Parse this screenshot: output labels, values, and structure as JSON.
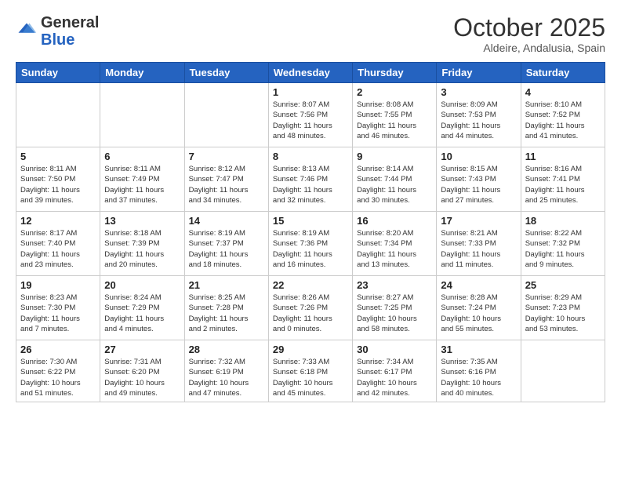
{
  "header": {
    "logo_general": "General",
    "logo_blue": "Blue",
    "month_title": "October 2025",
    "subtitle": "Aldeire, Andalusia, Spain"
  },
  "weekdays": [
    "Sunday",
    "Monday",
    "Tuesday",
    "Wednesday",
    "Thursday",
    "Friday",
    "Saturday"
  ],
  "weeks": [
    [
      {
        "day": "",
        "info": ""
      },
      {
        "day": "",
        "info": ""
      },
      {
        "day": "",
        "info": ""
      },
      {
        "day": "1",
        "info": "Sunrise: 8:07 AM\nSunset: 7:56 PM\nDaylight: 11 hours\nand 48 minutes."
      },
      {
        "day": "2",
        "info": "Sunrise: 8:08 AM\nSunset: 7:55 PM\nDaylight: 11 hours\nand 46 minutes."
      },
      {
        "day": "3",
        "info": "Sunrise: 8:09 AM\nSunset: 7:53 PM\nDaylight: 11 hours\nand 44 minutes."
      },
      {
        "day": "4",
        "info": "Sunrise: 8:10 AM\nSunset: 7:52 PM\nDaylight: 11 hours\nand 41 minutes."
      }
    ],
    [
      {
        "day": "5",
        "info": "Sunrise: 8:11 AM\nSunset: 7:50 PM\nDaylight: 11 hours\nand 39 minutes."
      },
      {
        "day": "6",
        "info": "Sunrise: 8:11 AM\nSunset: 7:49 PM\nDaylight: 11 hours\nand 37 minutes."
      },
      {
        "day": "7",
        "info": "Sunrise: 8:12 AM\nSunset: 7:47 PM\nDaylight: 11 hours\nand 34 minutes."
      },
      {
        "day": "8",
        "info": "Sunrise: 8:13 AM\nSunset: 7:46 PM\nDaylight: 11 hours\nand 32 minutes."
      },
      {
        "day": "9",
        "info": "Sunrise: 8:14 AM\nSunset: 7:44 PM\nDaylight: 11 hours\nand 30 minutes."
      },
      {
        "day": "10",
        "info": "Sunrise: 8:15 AM\nSunset: 7:43 PM\nDaylight: 11 hours\nand 27 minutes."
      },
      {
        "day": "11",
        "info": "Sunrise: 8:16 AM\nSunset: 7:41 PM\nDaylight: 11 hours\nand 25 minutes."
      }
    ],
    [
      {
        "day": "12",
        "info": "Sunrise: 8:17 AM\nSunset: 7:40 PM\nDaylight: 11 hours\nand 23 minutes."
      },
      {
        "day": "13",
        "info": "Sunrise: 8:18 AM\nSunset: 7:39 PM\nDaylight: 11 hours\nand 20 minutes."
      },
      {
        "day": "14",
        "info": "Sunrise: 8:19 AM\nSunset: 7:37 PM\nDaylight: 11 hours\nand 18 minutes."
      },
      {
        "day": "15",
        "info": "Sunrise: 8:19 AM\nSunset: 7:36 PM\nDaylight: 11 hours\nand 16 minutes."
      },
      {
        "day": "16",
        "info": "Sunrise: 8:20 AM\nSunset: 7:34 PM\nDaylight: 11 hours\nand 13 minutes."
      },
      {
        "day": "17",
        "info": "Sunrise: 8:21 AM\nSunset: 7:33 PM\nDaylight: 11 hours\nand 11 minutes."
      },
      {
        "day": "18",
        "info": "Sunrise: 8:22 AM\nSunset: 7:32 PM\nDaylight: 11 hours\nand 9 minutes."
      }
    ],
    [
      {
        "day": "19",
        "info": "Sunrise: 8:23 AM\nSunset: 7:30 PM\nDaylight: 11 hours\nand 7 minutes."
      },
      {
        "day": "20",
        "info": "Sunrise: 8:24 AM\nSunset: 7:29 PM\nDaylight: 11 hours\nand 4 minutes."
      },
      {
        "day": "21",
        "info": "Sunrise: 8:25 AM\nSunset: 7:28 PM\nDaylight: 11 hours\nand 2 minutes."
      },
      {
        "day": "22",
        "info": "Sunrise: 8:26 AM\nSunset: 7:26 PM\nDaylight: 11 hours\nand 0 minutes."
      },
      {
        "day": "23",
        "info": "Sunrise: 8:27 AM\nSunset: 7:25 PM\nDaylight: 10 hours\nand 58 minutes."
      },
      {
        "day": "24",
        "info": "Sunrise: 8:28 AM\nSunset: 7:24 PM\nDaylight: 10 hours\nand 55 minutes."
      },
      {
        "day": "25",
        "info": "Sunrise: 8:29 AM\nSunset: 7:23 PM\nDaylight: 10 hours\nand 53 minutes."
      }
    ],
    [
      {
        "day": "26",
        "info": "Sunrise: 7:30 AM\nSunset: 6:22 PM\nDaylight: 10 hours\nand 51 minutes."
      },
      {
        "day": "27",
        "info": "Sunrise: 7:31 AM\nSunset: 6:20 PM\nDaylight: 10 hours\nand 49 minutes."
      },
      {
        "day": "28",
        "info": "Sunrise: 7:32 AM\nSunset: 6:19 PM\nDaylight: 10 hours\nand 47 minutes."
      },
      {
        "day": "29",
        "info": "Sunrise: 7:33 AM\nSunset: 6:18 PM\nDaylight: 10 hours\nand 45 minutes."
      },
      {
        "day": "30",
        "info": "Sunrise: 7:34 AM\nSunset: 6:17 PM\nDaylight: 10 hours\nand 42 minutes."
      },
      {
        "day": "31",
        "info": "Sunrise: 7:35 AM\nSunset: 6:16 PM\nDaylight: 10 hours\nand 40 minutes."
      },
      {
        "day": "",
        "info": ""
      }
    ]
  ]
}
